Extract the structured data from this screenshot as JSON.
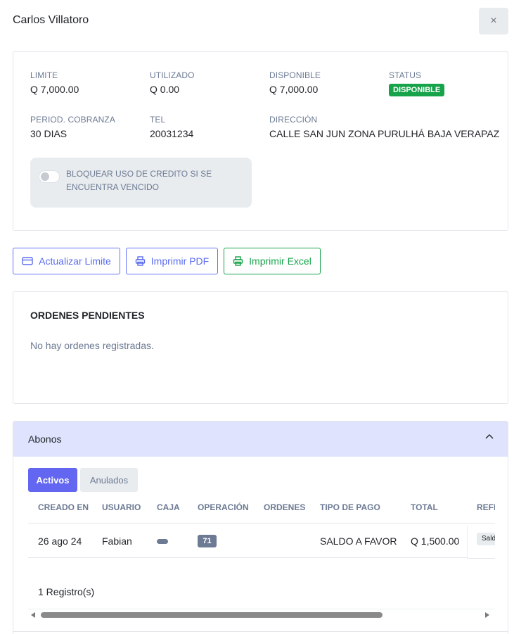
{
  "modal": {
    "title": "Carlos Villatoro",
    "close_label": "×"
  },
  "info": {
    "limite": {
      "label": "LIMITE",
      "value": "Q 7,000.00"
    },
    "utilizado": {
      "label": "UTILIZADO",
      "value": "Q 0.00"
    },
    "disponible": {
      "label": "DISPONIBLE",
      "value": "Q 7,000.00"
    },
    "status": {
      "label": "STATUS",
      "value": "DISPONIBLE",
      "color": "#16a34a"
    },
    "periodo": {
      "label": "PERIOD. COBRANZA",
      "value": "30 DIAS"
    },
    "tel": {
      "label": "TEL",
      "value": "20031234"
    },
    "direccion": {
      "label": "DIRECCIÓN",
      "value": "CALLE SAN JUN ZONA PURULHÁ BAJA VERAPAZ"
    }
  },
  "toggle": {
    "label": "BLOQUEAR USO DE CREDITO SI SE ENCUENTRA VENCIDO",
    "checked": false
  },
  "actions": {
    "actualizar": "Actualizar Limite",
    "pdf": "Imprimir PDF",
    "excel": "Imprimir Excel"
  },
  "orders": {
    "title": "ORDENES PENDIENTES",
    "empty": "No hay ordenes registradas."
  },
  "abonos": {
    "title": "Abonos",
    "tabs": {
      "activos": "Activos",
      "anulados": "Anulados"
    },
    "columns": {
      "creado_en": "CREADO EN",
      "usuario": "USUARIO",
      "caja": "CAJA",
      "operacion": "OPERACIÓN",
      "ordenes": "ORDENES",
      "tipo_pago": "TIPO DE PAGO",
      "total": "TOTAL",
      "referencia": "REFE"
    },
    "rows": [
      {
        "creado_en": "26 ago 24",
        "usuario": "Fabian",
        "operacion": "71",
        "ordenes": "",
        "tipo_pago": "SALDO A FAVOR",
        "total": "Q 1,500.00",
        "referencia": "Sald"
      }
    ],
    "count": "1 Registro(s)"
  },
  "colors": {
    "primary": "#6366f1",
    "success": "#16a34a",
    "header_bg": "#dfe3fe"
  }
}
